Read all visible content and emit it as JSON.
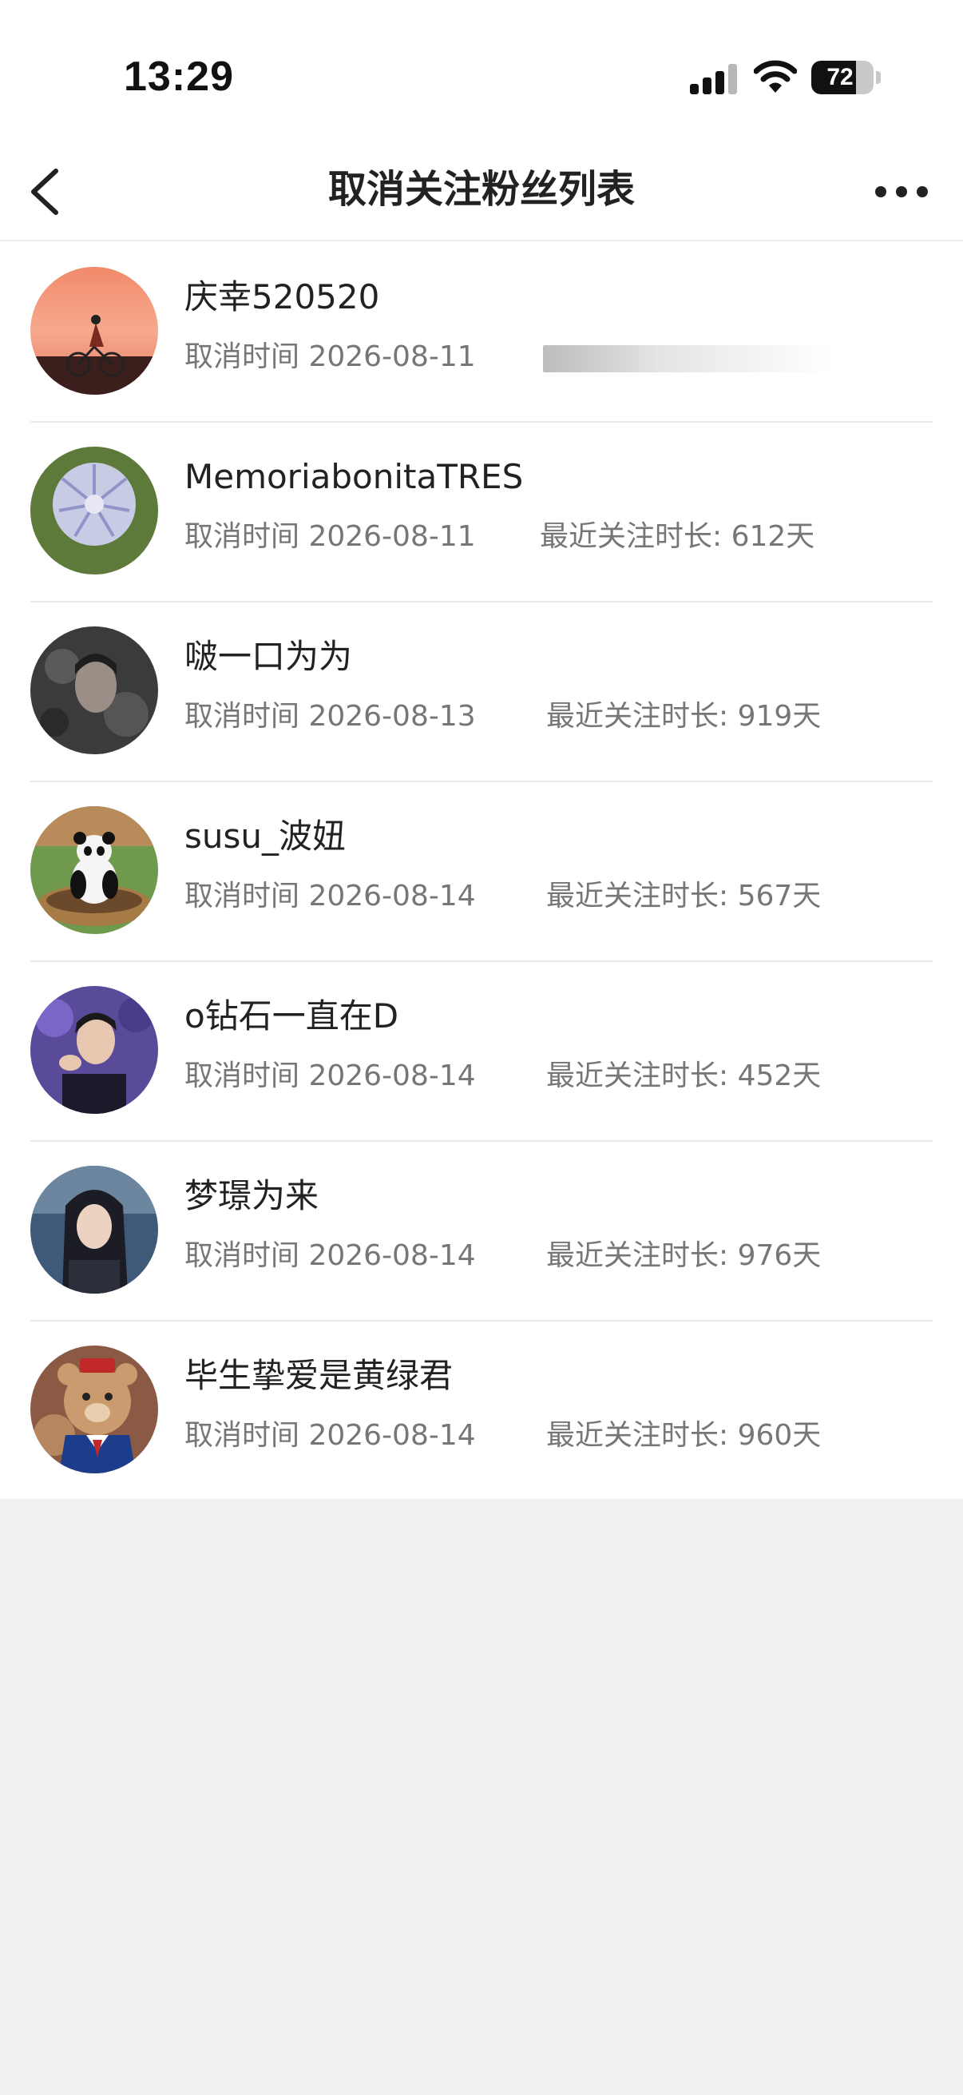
{
  "status_bar": {
    "time": "13:29",
    "battery": "72",
    "battery_level": 0.72
  },
  "nav": {
    "title": "取消关注粉丝列表",
    "back_icon": "chevron-left-icon",
    "more_icon": "more-dots-icon"
  },
  "list": [
    {
      "name": "庆幸520520",
      "time": "取消时间 2026-08-11",
      "duration": ""
    },
    {
      "name": "MemoriabonitaTRES",
      "time": "取消时间 2026-08-11",
      "duration": "最近关注时长: 612天"
    },
    {
      "name": "啵一口为为",
      "time": "取消时间 2026-08-13",
      "duration": "最近关注时长: 919天"
    },
    {
      "name": "susu_波妞",
      "time": "取消时间 2026-08-14",
      "duration": "最近关注时长: 567天"
    },
    {
      "name": "o钻石一直在D",
      "time": "取消时间 2026-08-14",
      "duration": "最近关注时长: 452天"
    },
    {
      "name": "梦璟为来",
      "time": "取消时间 2026-08-14",
      "duration": "最近关注时长: 976天"
    },
    {
      "name": "毕生挚爱是黄绿君",
      "time": "取消时间 2026-08-14",
      "duration": "最近关注时长: 960天"
    }
  ]
}
